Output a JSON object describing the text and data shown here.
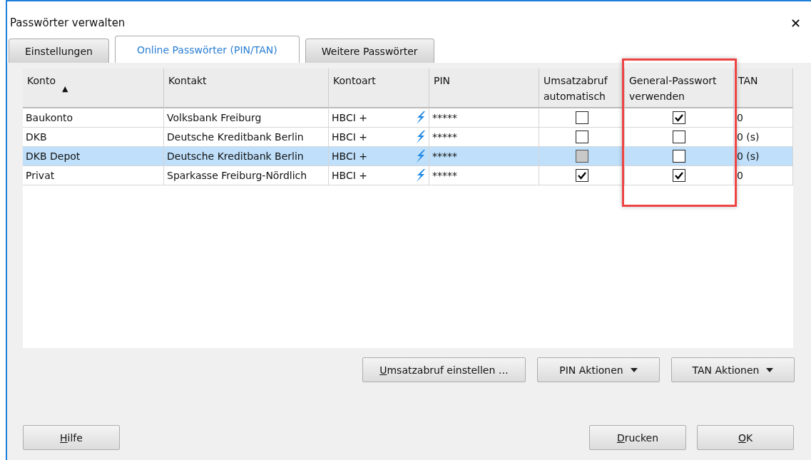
{
  "window": {
    "title": "Passwörter verwalten",
    "close": "✕"
  },
  "tabs": [
    {
      "label": "Einstellungen",
      "selected": false
    },
    {
      "label": "Online Passwörter (PIN/TAN)",
      "selected": true
    },
    {
      "label": "Weitere Passwörter",
      "selected": false
    }
  ],
  "table": {
    "columns": [
      {
        "label": "Konto",
        "sort": "▲"
      },
      {
        "label": "Kontakt"
      },
      {
        "label": "Kontoart"
      },
      {
        "label": "PIN"
      },
      {
        "label": "Umsatzabruf automatisch"
      },
      {
        "label": "General-Passwort verwenden",
        "highlighted": true
      },
      {
        "label": "TAN"
      }
    ],
    "rows": [
      {
        "konto": "Baukonto",
        "kontakt": "Volksbank Freiburg",
        "kontoart": "HBCI +",
        "pin": "*****",
        "umsatzabruf": {
          "checked": false,
          "disabled": false
        },
        "general": {
          "checked": true,
          "disabled": false
        },
        "tan": "0",
        "selected": false
      },
      {
        "konto": "DKB",
        "kontakt": "Deutsche Kreditbank Berlin",
        "kontoart": "HBCI +",
        "pin": "*****",
        "umsatzabruf": {
          "checked": false,
          "disabled": false
        },
        "general": {
          "checked": false,
          "disabled": false
        },
        "tan": "0 (s)",
        "selected": false
      },
      {
        "konto": "DKB Depot",
        "kontakt": "Deutsche Kreditbank Berlin",
        "kontoart": "HBCI +",
        "pin": "*****",
        "umsatzabruf": {
          "checked": false,
          "disabled": true
        },
        "general": {
          "checked": false,
          "disabled": false
        },
        "tan": "0 (s)",
        "selected": true
      },
      {
        "konto": "Privat",
        "kontakt": "Sparkasse Freiburg-Nördlich",
        "kontoart": "HBCI +",
        "pin": "*****",
        "umsatzabruf": {
          "checked": true,
          "disabled": false
        },
        "general": {
          "checked": true,
          "disabled": false
        },
        "tan": "0",
        "selected": false
      }
    ]
  },
  "actions": [
    {
      "key": "U",
      "rest": "msatzabruf einstellen …"
    },
    {
      "rest": "PIN Aktionen",
      "caret": true
    },
    {
      "rest": "TAN Aktionen",
      "caret": true
    }
  ],
  "footer_left": [
    {
      "key": "H",
      "rest": "ilfe"
    }
  ],
  "footer_right": [
    {
      "key": "D",
      "rest": "rucken"
    },
    {
      "key": "O",
      "rest": "K"
    }
  ]
}
